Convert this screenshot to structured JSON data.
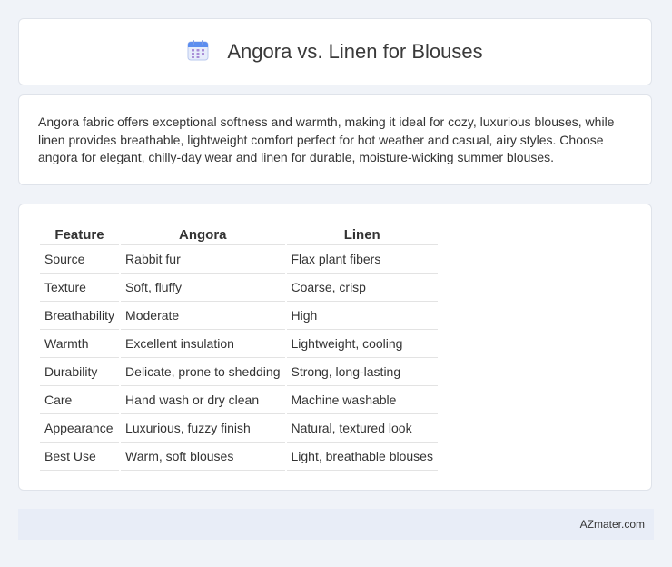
{
  "header": {
    "title": "Angora vs. Linen for Blouses",
    "icon": "calendar-icon"
  },
  "description": "Angora fabric offers exceptional softness and warmth, making it ideal for cozy, luxurious blouses, while linen provides breathable, lightweight comfort perfect for hot weather and casual, airy styles. Choose angora for elegant, chilly-day wear and linen for durable, moisture-wicking summer blouses.",
  "table": {
    "headers": [
      "Feature",
      "Angora",
      "Linen"
    ],
    "rows": [
      [
        "Source",
        "Rabbit fur",
        "Flax plant fibers"
      ],
      [
        "Texture",
        "Soft, fluffy",
        "Coarse, crisp"
      ],
      [
        "Breathability",
        "Moderate",
        "High"
      ],
      [
        "Warmth",
        "Excellent insulation",
        "Lightweight, cooling"
      ],
      [
        "Durability",
        "Delicate, prone to shedding",
        "Strong, long-lasting"
      ],
      [
        "Care",
        "Hand wash or dry clean",
        "Machine washable"
      ],
      [
        "Appearance",
        "Luxurious, fuzzy finish",
        "Natural, textured look"
      ],
      [
        "Best Use",
        "Warm, soft blouses",
        "Light, breathable blouses"
      ]
    ]
  },
  "footer": {
    "brand": "AZmater.com"
  },
  "colors": {
    "page_bg": "#f0f3f8",
    "card_bg": "#ffffff",
    "footer_bg": "#e8edf7",
    "icon_accent": "#5b8def"
  }
}
